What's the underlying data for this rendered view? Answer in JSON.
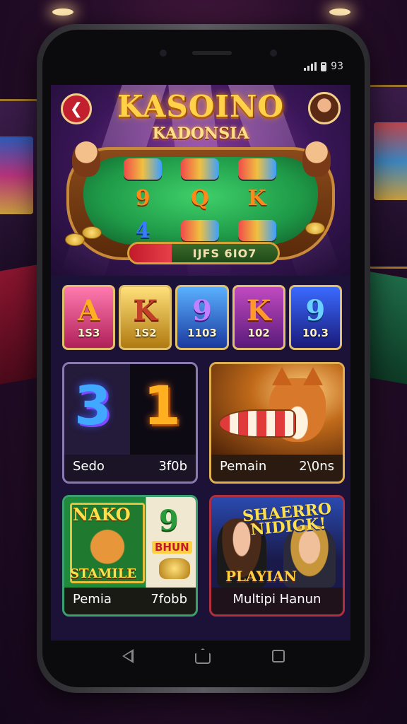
{
  "status": {
    "time": "93"
  },
  "hero": {
    "title": "KASOINO",
    "subtitle": "KADONSIA",
    "reels": [
      {
        "text": "",
        "style": "chips"
      },
      {
        "text": "",
        "style": "chips"
      },
      {
        "text": "",
        "style": "chips"
      },
      {
        "text": "9",
        "style": "orange"
      },
      {
        "text": "Q",
        "style": "orange"
      },
      {
        "text": "K",
        "style": "orange"
      },
      {
        "text": "4",
        "style": "blue"
      },
      {
        "text": "",
        "style": "chips"
      },
      {
        "text": "",
        "style": "chips"
      }
    ],
    "action_label": "IJFS 6IO7"
  },
  "tiles": [
    {
      "letter": "A",
      "number": "1S3"
    },
    {
      "letter": "K",
      "number": "1S2"
    },
    {
      "letter": "9",
      "number": "1103"
    },
    {
      "letter": "K",
      "number": "102"
    },
    {
      "letter": "9",
      "number": "10.3"
    }
  ],
  "cards": [
    {
      "art_text_1": "3",
      "art_text_2": "1",
      "name": "Sedo",
      "value": "3f0b"
    },
    {
      "name": "Pemain",
      "value": "2\\0ns"
    },
    {
      "art_title": "NAKO",
      "art_sub": "STAMILE",
      "art_num": "9",
      "art_tag": "BHUN",
      "name": "Pemia",
      "value": "7fobb"
    },
    {
      "art_title": "SHAERRO NIDIGK!",
      "art_tag": "PLAYIAN",
      "name": "Multipi Hanun",
      "value": ""
    }
  ],
  "nav": {
    "icons": [
      "back-triangle-icon",
      "home-icon",
      "recent-apps-icon"
    ]
  },
  "colors": {
    "accent": "#ffd24a",
    "back_button": "#c2202e",
    "screen_bg": "#1c1238"
  }
}
